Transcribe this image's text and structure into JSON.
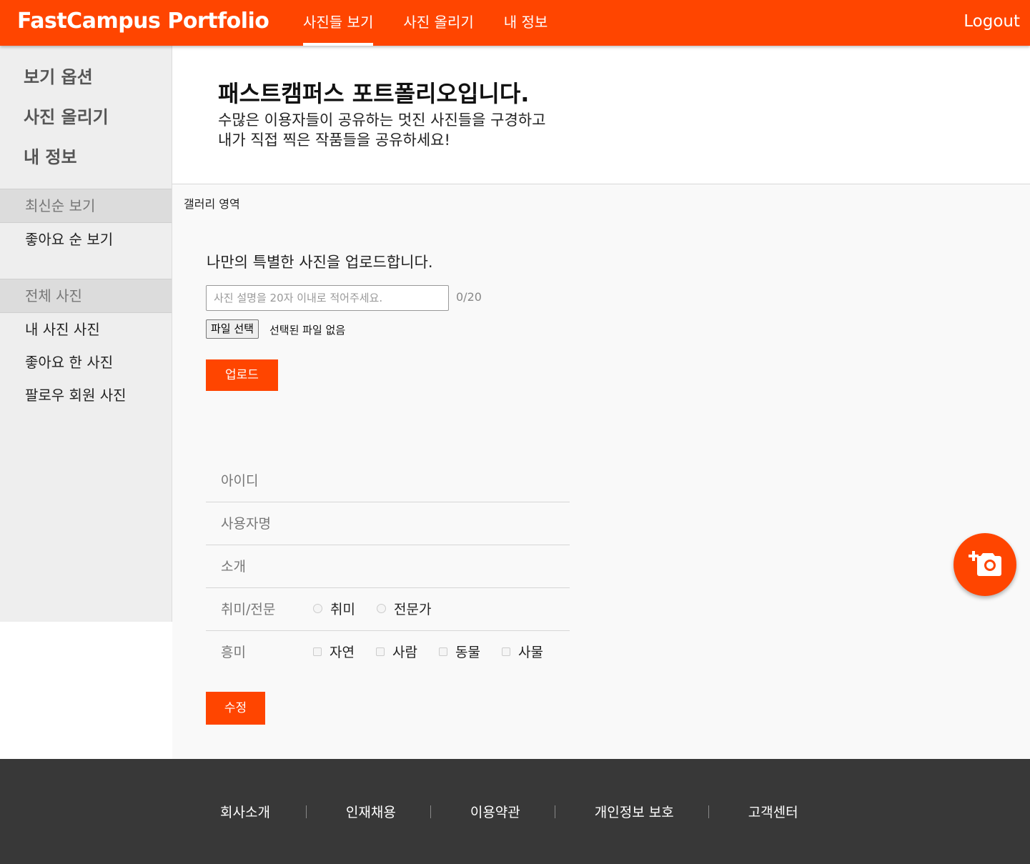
{
  "header": {
    "brand": "FastCampus Portfolio",
    "nav": [
      "사진들 보기",
      "사진 올리기",
      "내 정보"
    ],
    "active_nav": "사진들 보기",
    "logout": "Logout",
    "accent_color": "#ff4500"
  },
  "sidebar": {
    "headings": [
      "보기 옵션",
      "사진 올리기",
      "내 정보"
    ],
    "sort_options": [
      "최신순 보기",
      "좋아요 순 보기"
    ],
    "selected_sort": "최신순 보기",
    "filter_options": [
      "전체 사진",
      "내 사진 사진",
      "좋아요 한 사진",
      "팔로우 회원 사진"
    ],
    "selected_filter": "전체 사진"
  },
  "intro": {
    "title": "패스트캠퍼스 포트폴리오입니다.",
    "line1": "수많은 이용자들이 공유하는 멋진 사진들을 구경하고",
    "line2": "내가 직접 찍은 작품들을 공유하세요!"
  },
  "gallery": {
    "label": "갤러리 영역"
  },
  "upload": {
    "title": "나만의 특별한 사진을 업로드합니다.",
    "placeholder": "사진 설명을 20자 이내로 적어주세요.",
    "value": "",
    "char_count": "0/20",
    "file_button": "파일 선택",
    "file_status": "선택된 파일 없음",
    "submit": "업로드"
  },
  "profile_form": {
    "id_label": "아이디",
    "username_label": "사용자명",
    "intro_label": "소개",
    "level_label": "취미/전문",
    "level_options": [
      "취미",
      "전문가"
    ],
    "interest_label": "흥미",
    "interest_options": [
      "자연",
      "사람",
      "동물",
      "사물"
    ],
    "submit": "수정"
  },
  "fab": {
    "icon": "add-photo-icon"
  },
  "footer": {
    "links": [
      "회사소개",
      "인재채용",
      "이용약관",
      "개인정보 보호",
      "고객센터"
    ]
  }
}
